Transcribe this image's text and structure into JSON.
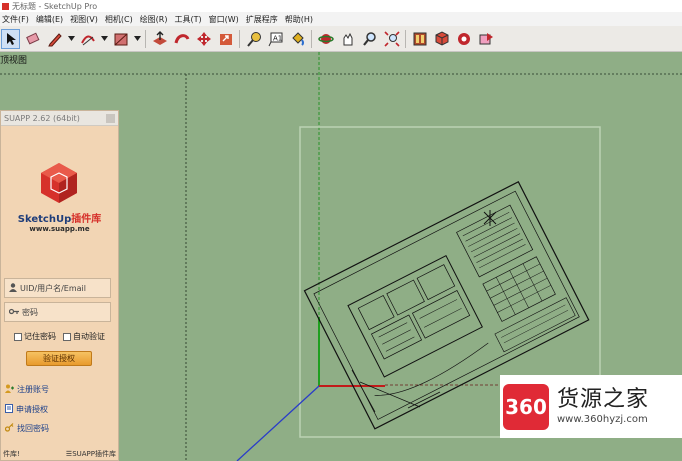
{
  "window": {
    "title": "无标题 - SketchUp Pro"
  },
  "menu": [
    "文件(F)",
    "编辑(E)",
    "视图(V)",
    "相机(C)",
    "绘图(R)",
    "工具(T)",
    "窗口(W)",
    "扩展程序",
    "帮助(H)"
  ],
  "viewport": {
    "label": "顶视图"
  },
  "plugin": {
    "title": "SUAPP 2.62 (64bit)",
    "brand_en": "SketchUp",
    "brand_zh": "插件库",
    "url": "www.suapp.me",
    "username_placeholder": "UID/用户名/Email",
    "password_placeholder": "密码",
    "remember_label": "记住密码",
    "auto_verify_label": "自动验证",
    "verify_button": "验证授权",
    "register_link": "注册账号",
    "apply_link": "申请授权",
    "recover_link": "找回密码",
    "footer_left": "件库!",
    "footer_right": "☰SUAPP插件库"
  },
  "watermark": {
    "logo_text": "360",
    "title": "货源之家",
    "url": "www.360hyzj.com"
  },
  "colors": {
    "accent": "#d6312b",
    "viewport_bg": "#8fae86",
    "panel_bg": "#f2d5b4"
  },
  "toolbar_icons": [
    "select-arrow-icon",
    "eraser-icon",
    "pencil-icon",
    "arc-icon",
    "rectangle-icon",
    "push-pull-icon",
    "follow-me-icon",
    "move-icon",
    "rotate-icon",
    "tape-measure-icon",
    "text-label-icon",
    "paint-bucket-icon",
    "orbit-icon",
    "pan-icon",
    "zoom-icon",
    "zoom-extents-icon",
    "warehouse-icon",
    "components-icon",
    "extensions-icon"
  ]
}
